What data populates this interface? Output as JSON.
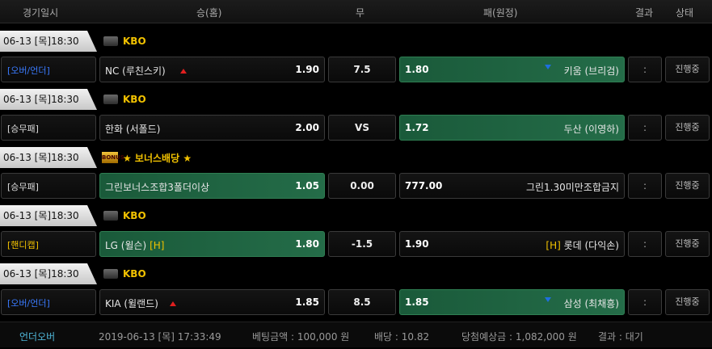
{
  "header": {
    "date": "경기일시",
    "home": "승(홈)",
    "draw": "무",
    "away": "패(원정)",
    "result": "결과",
    "status": "상태"
  },
  "rows": [
    {
      "datetime": "06-13 [목]18:30",
      "league": "KBO",
      "type": "[오버/언더]",
      "type_color": "#3a7bff",
      "home": "NC (루친스키)",
      "home_odd": "1.90",
      "mid": "7.5",
      "away_odd": "1.80",
      "away": "키움 (브리검)",
      "result": ":",
      "status": "진행중"
    },
    {
      "datetime": "06-13 [목]18:30",
      "league": "KBO",
      "type": "[승무패]",
      "type_color": "#dddddd",
      "home": "한화 (서폴드)",
      "home_odd": "2.00",
      "mid": "VS",
      "away_odd": "1.72",
      "away": "두산 (이영하)",
      "result": ":",
      "status": "진행중"
    },
    {
      "datetime": "06-13 [목]18:30",
      "league": "★ 보너스배당 ★",
      "bonus_icon": "BONUS",
      "type": "[승무패]",
      "type_color": "#dddddd",
      "home": "그린보너스조합3폴더이상",
      "home_odd": "1.05",
      "mid": "0.00",
      "away_odd": "777.00",
      "away": "그린1.30미만조합금지",
      "result": ":",
      "status": "진행중"
    },
    {
      "datetime": "06-13 [목]18:30",
      "league": "KBO",
      "type": "[핸디캡]",
      "type_color": "#f2c200",
      "home": "LG (윌슨)",
      "home_mark": "[H]",
      "home_odd": "1.80",
      "mid": "-1.5",
      "away_odd": "1.90",
      "away_mark": "[H]",
      "away": "롯데 (다익손)",
      "result": ":",
      "status": "진행중"
    },
    {
      "datetime": "06-13 [목]18:30",
      "league": "KBO",
      "type": "[오버/언더]",
      "type_color": "#3a7bff",
      "home": "KIA (윌랜드)",
      "home_odd": "1.85",
      "mid": "8.5",
      "away_odd": "1.85",
      "away": "삼성 (최채흥)",
      "result": ":",
      "status": "진행중"
    }
  ],
  "footer": {
    "bet_type": "언더오버",
    "timestamp": "2019-06-13 [목] 17:33:49",
    "bet_amount": "베팅금액 : 100,000 원",
    "odds": "배당 : 10.82",
    "expected_win": "당첨예상금 : 1,082,000 원",
    "result": "결과 : 대기"
  },
  "colors": {
    "selected_bg": "#246c48",
    "league": "#f2c200",
    "over_under": "#3a7bff",
    "handicap": "#f2c200",
    "up_arrow": "#e01f1f",
    "down_arrow": "#1e6fe0"
  },
  "icons": {
    "league": "league-flag-icon",
    "bonus": "bonus-icon",
    "up": "up-arrow-icon",
    "down": "down-arrow-icon"
  }
}
